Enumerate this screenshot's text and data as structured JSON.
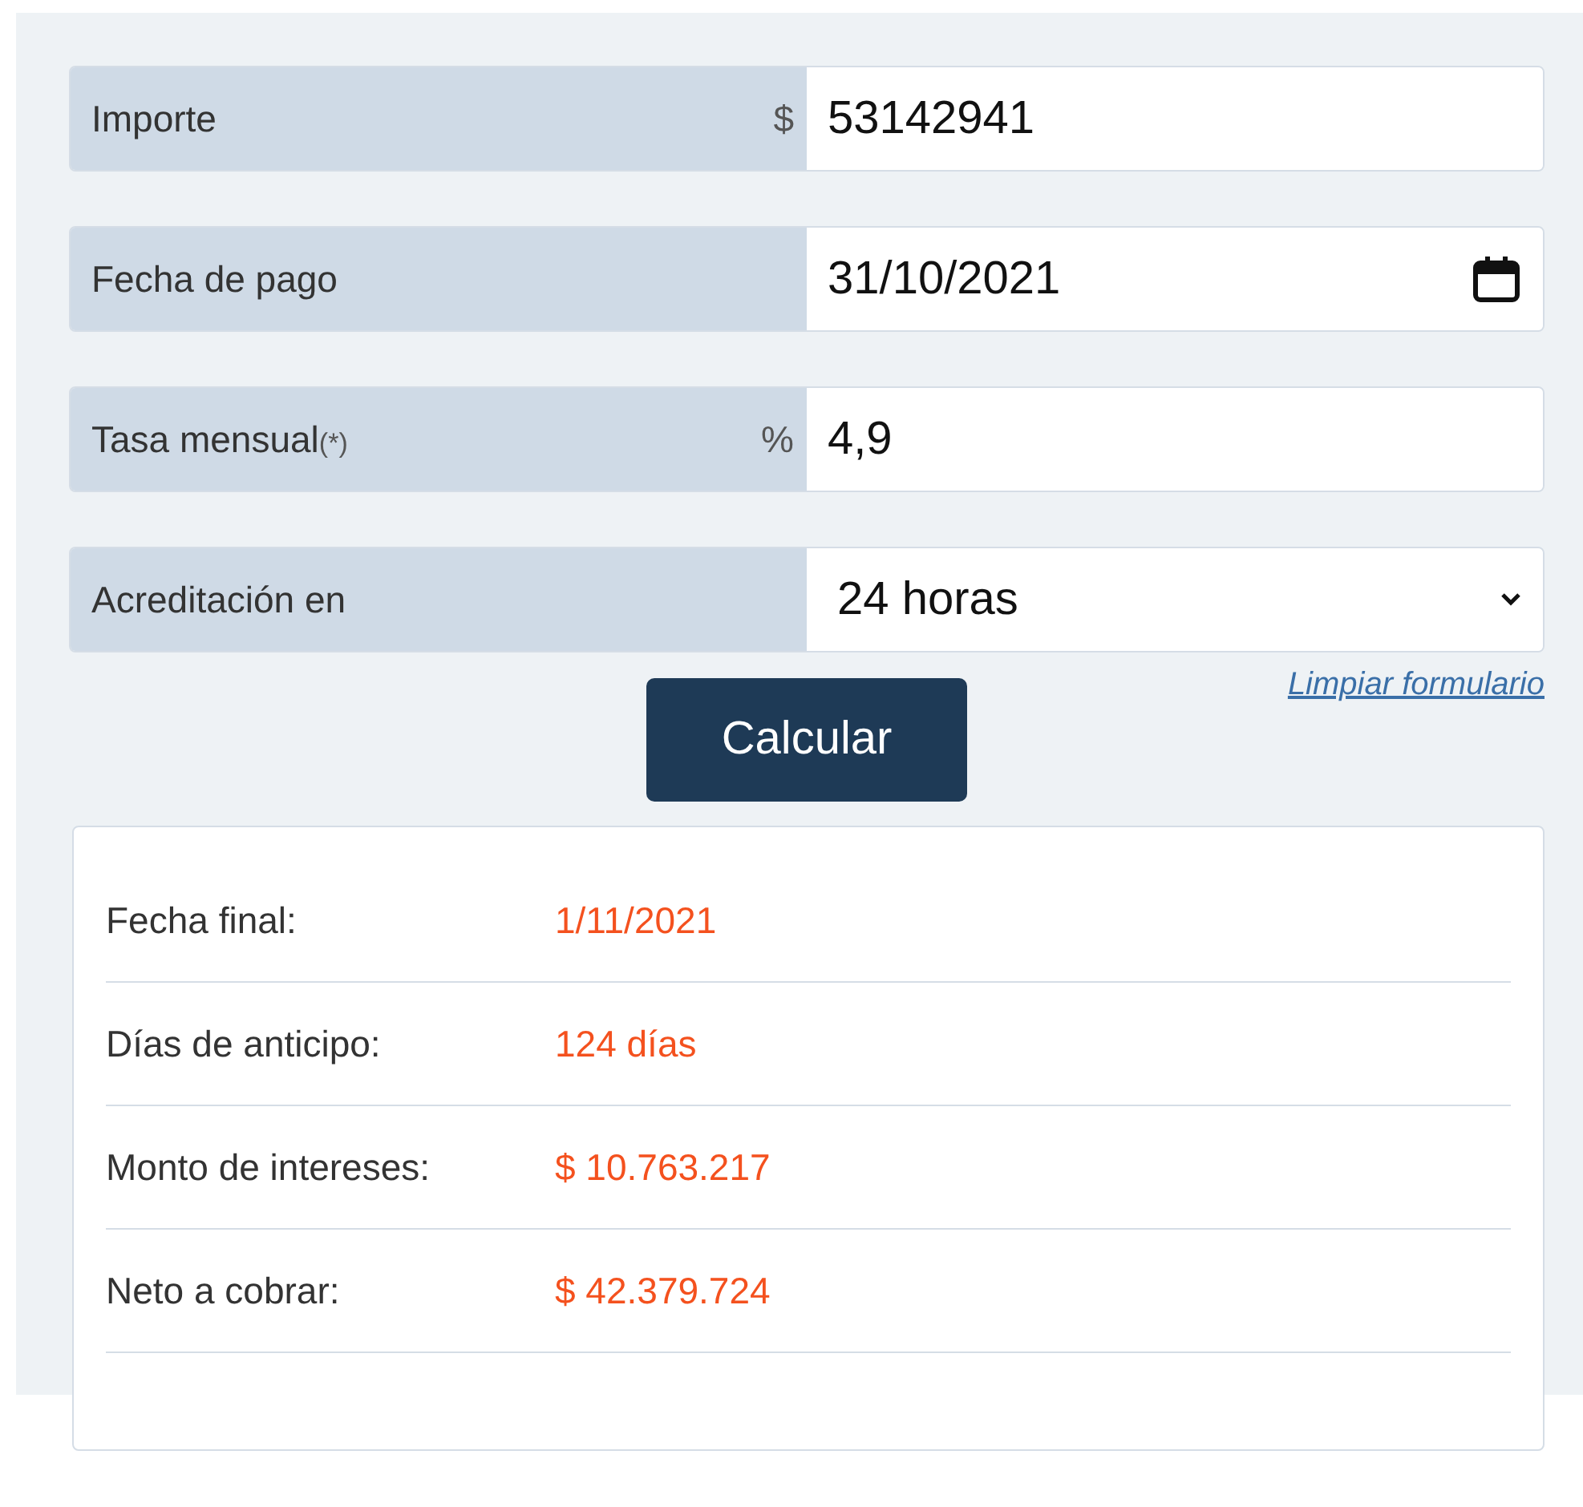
{
  "fields": [
    {
      "kind": "text",
      "label": "Importe",
      "prefix": "$",
      "value": "53142941"
    },
    {
      "kind": "date",
      "label": "Fecha de pago",
      "value": "31/10/2021"
    },
    {
      "kind": "text",
      "label": "Tasa mensual",
      "note": "(*)",
      "prefix": "%",
      "value": "4,9"
    },
    {
      "kind": "select",
      "label": "Acreditación en",
      "value": "24 horas"
    }
  ],
  "clear_link": "Limpiar formulario",
  "submit_button": "Calcular",
  "results": [
    {
      "label": "Fecha final:",
      "value": "1/11/2021"
    },
    {
      "label": "Días de anticipo:",
      "value": "124 días"
    },
    {
      "label": "Monto de intereses:",
      "value": "$ 10.763.217"
    },
    {
      "label": "Neto a cobrar:",
      "value": "$ 42.379.724"
    }
  ]
}
